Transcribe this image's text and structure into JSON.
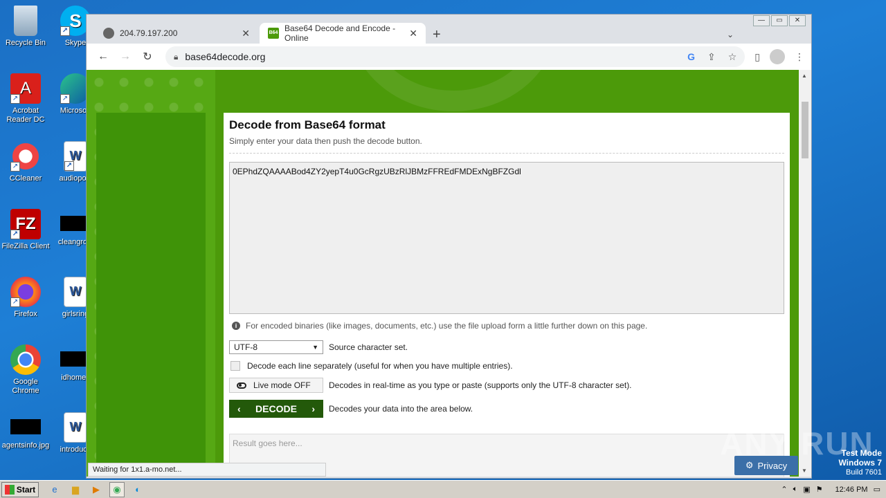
{
  "desktop": {
    "icons": [
      {
        "label": "Recycle Bin"
      },
      {
        "label": "Skype"
      },
      {
        "label": "Acrobat Reader DC"
      },
      {
        "label": "Microsoft"
      },
      {
        "label": "CCleaner"
      },
      {
        "label": "audiopolit"
      },
      {
        "label": "FileZilla Client"
      },
      {
        "label": "cleangrow"
      },
      {
        "label": "Firefox"
      },
      {
        "label": "girlsring"
      },
      {
        "label": "Google Chrome"
      },
      {
        "label": "idhomes"
      },
      {
        "label": "agentsinfo.jpg"
      },
      {
        "label": "introducti"
      }
    ]
  },
  "browser": {
    "tabs": [
      {
        "title": "204.79.197.200"
      },
      {
        "title": "Base64 Decode and Encode - Online"
      }
    ],
    "url": "base64decode.org",
    "status": "Waiting for 1x1.a-mo.net..."
  },
  "page": {
    "title": "Decode from Base64 format",
    "subtitle": "Simply enter your data then push the decode button.",
    "input_value": "0EPhdZQAAAABod4ZY2yepT4u0GcRgzUBzRlJBMzFFREdFMDExNgBFZGdl",
    "info": "For encoded binaries (like images, documents, etc.) use the file upload form a little further down on this page.",
    "charset_value": "UTF-8",
    "charset_label": "Source character set.",
    "lines_label": "Decode each line separately (useful for when you have multiple entries).",
    "live_mode_label": "Live mode OFF",
    "live_mode_desc": "Decodes in real-time as you type or paste (supports only the UTF-8 character set).",
    "decode_label": "DECODE",
    "decode_desc": "Decodes your data into the area below.",
    "result_placeholder": "Result goes here...",
    "privacy_label": "Privacy"
  },
  "overlay": {
    "watermark": "ANY RUN",
    "test_mode": "Test Mode",
    "os": "Windows 7",
    "build": "Build 7601"
  },
  "taskbar": {
    "start_label": "Start",
    "time": "12:46 PM"
  },
  "colors": {
    "site_green": "#4c9a0a",
    "decode_button": "#23590a",
    "desktop_blue": "#1e7fd6"
  }
}
